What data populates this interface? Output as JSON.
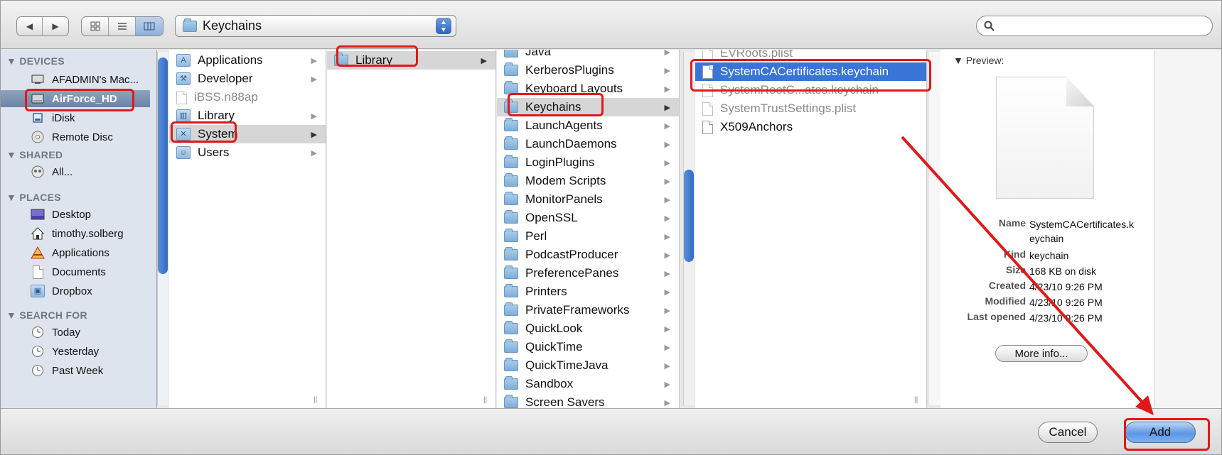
{
  "toolbar": {
    "nav_back": "◀",
    "nav_forward": "▶",
    "view_icons": "icon-view",
    "view_list": "list-view",
    "view_columns": "column-view",
    "location": "Keychains",
    "search_value": "",
    "search_placeholder": ""
  },
  "sidebar": {
    "devices_header": "▼ DEVICES",
    "devices": [
      {
        "label": "AFADMIN's Mac...",
        "icon": "computer-icon"
      },
      {
        "label": "AirForce_HD",
        "icon": "hard-drive-icon"
      },
      {
        "label": "iDisk",
        "icon": "idisk-icon"
      },
      {
        "label": "Remote Disc",
        "icon": "disc-icon"
      }
    ],
    "shared_header": "▼ SHARED",
    "shared": [
      {
        "label": "All...",
        "icon": "network-icon"
      }
    ],
    "places_header": "▼ PLACES",
    "places": [
      {
        "label": "Desktop",
        "icon": "desktop-icon"
      },
      {
        "label": "timothy.solberg",
        "icon": "home-icon"
      },
      {
        "label": "Applications",
        "icon": "applications-icon"
      },
      {
        "label": "Documents",
        "icon": "documents-icon"
      },
      {
        "label": "Dropbox",
        "icon": "dropbox-icon"
      }
    ],
    "search_header": "▼ SEARCH FOR",
    "search_for": [
      {
        "label": "Today",
        "icon": "clock-icon"
      },
      {
        "label": "Yesterday",
        "icon": "clock-icon"
      },
      {
        "label": "Past Week",
        "icon": "clock-icon"
      }
    ]
  },
  "columns": {
    "col1": [
      "Applications",
      "Developer",
      "iBSS.n88ap",
      "Library",
      "System",
      "Users"
    ],
    "col2": [
      "Library"
    ],
    "col3": [
      "Java",
      "KerberosPlugins",
      "Keyboard Layouts",
      "Keychains",
      "LaunchAgents",
      "LaunchDaemons",
      "LoginPlugins",
      "Modem Scripts",
      "MonitorPanels",
      "OpenSSL",
      "Perl",
      "PodcastProducer",
      "PreferencePanes",
      "Printers",
      "PrivateFrameworks",
      "QuickLook",
      "QuickTime",
      "QuickTimeJava",
      "Sandbox",
      "Screen Savers"
    ],
    "col4": [
      "EVRoots.plist",
      "SystemCACertificates.keychain",
      "SystemRootC...ates.keychain",
      "SystemTrustSettings.plist",
      "X509Anchors"
    ]
  },
  "preview": {
    "label": "▼ Preview:",
    "name_key": "Name",
    "name_value": "SystemCACertificates.keychain",
    "kind_key": "Kind",
    "kind_value": "keychain",
    "size_key": "Size",
    "size_value": "168 KB on disk",
    "created_key": "Created",
    "created_value": "4/23/10 9:26 PM",
    "modified_key": "Modified",
    "modified_value": "4/23/10 9:26 PM",
    "opened_key": "Last opened",
    "opened_value": "4/23/10 9:26 PM",
    "more_info": "More info..."
  },
  "buttons": {
    "cancel": "Cancel",
    "add": "Add"
  },
  "colors": {
    "selection_blue": "#3875d7",
    "annotation_red": "#e21818",
    "sidebar_bg": "#dde4ee"
  }
}
